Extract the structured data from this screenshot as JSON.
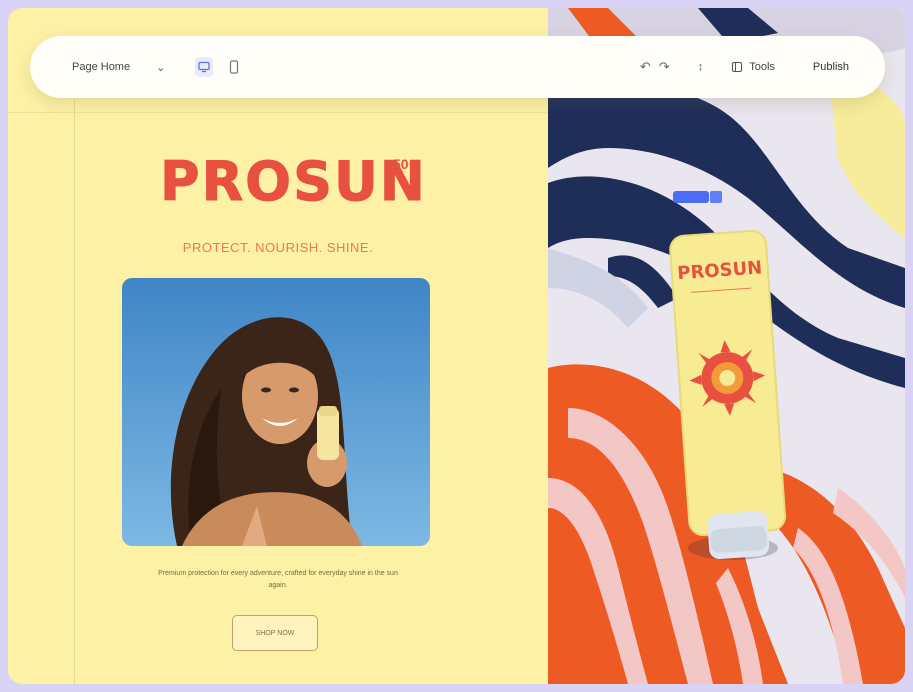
{
  "toolbar": {
    "page_selector": "Page Home",
    "undo_icon": "undo-icon",
    "redo_icon": "redo-icon",
    "tools_label": "Tools",
    "publish_label": "Publish"
  },
  "brand": {
    "logo": "PROSUN",
    "logo_superscript": "50+",
    "tagline": "PROTECT. NOURISH. SHINE."
  },
  "content": {
    "body_copy": "Premium protection for every adventure, crafted for everyday shine in the sun again.",
    "cta_label": "SHOP NOW"
  },
  "product": {
    "tube_logo": "PROSUN"
  },
  "colors": {
    "background": "#fdf1a6",
    "brand_red": "#e8503f",
    "frame": "#d9d3f6",
    "sky": "#4f93cf",
    "towel_orange": "#ee5a24",
    "towel_navy": "#1f2d59"
  }
}
